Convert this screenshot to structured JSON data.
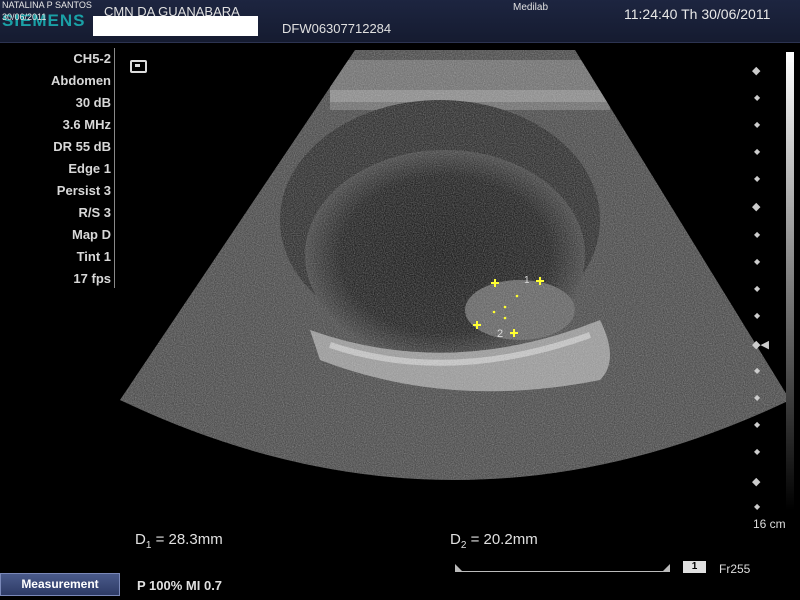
{
  "header": {
    "logo": "SIEMENS",
    "patient_name": "NATALINA P SANTOS",
    "patient_date": "30/06/2011",
    "institution": "CMN DA GUANABARA",
    "study_id": "DFW06307712284",
    "system": "Medilab",
    "datetime": "11:24:40  Th  30/06/2011"
  },
  "params": [
    "CH5-2",
    "Abdomen",
    "30 dB",
    "3.6 MHz",
    "DR 55 dB",
    "Edge 1",
    "Persist 3",
    "R/S 3",
    "Map D",
    "Tint 1",
    "17 fps"
  ],
  "scale": {
    "depth_label": "16 cm"
  },
  "calipers": {
    "c1": "1",
    "c2": "2"
  },
  "measurements": {
    "d1_prefix": "D",
    "d1_sub": "1",
    "d1_value": " = 28.3mm",
    "d2_prefix": "D",
    "d2_sub": "2",
    "d2_value": " = 20.2mm"
  },
  "footer": {
    "measurement_button": "Measurement",
    "power_mi": "P 100%   MI 0.7",
    "cine_badge": "1",
    "frame": "Fr255"
  },
  "icons": {
    "probe": "probe-orientation-icon",
    "calipers": "plus-icon"
  },
  "colors": {
    "caliper": "#ffff33",
    "header_bg": "#1d2540",
    "logo": "#1aa0a6"
  }
}
